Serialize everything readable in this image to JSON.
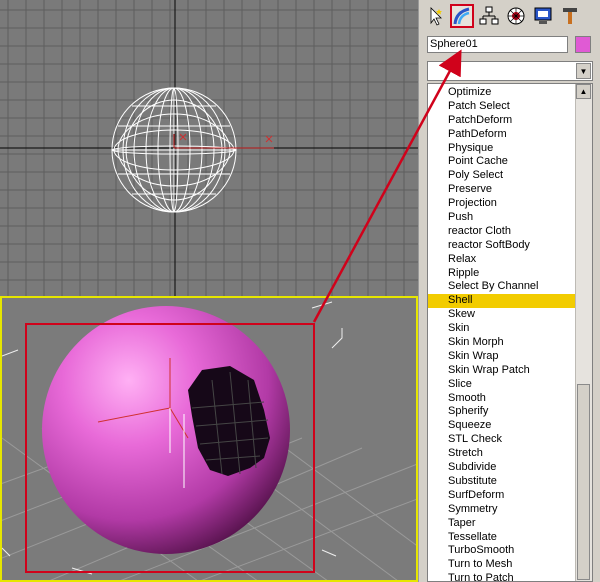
{
  "command_panel": {
    "tabs": [
      {
        "icon": "create-icon"
      },
      {
        "icon": "modify-icon",
        "highlighted": true
      },
      {
        "icon": "hierarchy-icon"
      },
      {
        "icon": "motion-icon"
      },
      {
        "icon": "display-icon"
      },
      {
        "icon": "utilities-icon"
      }
    ],
    "object_name": "Sphere01",
    "object_color": "#e05ad4",
    "modifier_list_value": ""
  },
  "modifiers": [
    {
      "label": "Optimize"
    },
    {
      "label": "Patch Select"
    },
    {
      "label": "PatchDeform"
    },
    {
      "label": "PathDeform"
    },
    {
      "label": "Physique"
    },
    {
      "label": "Point Cache"
    },
    {
      "label": "Poly Select"
    },
    {
      "label": "Preserve"
    },
    {
      "label": "Projection"
    },
    {
      "label": "Push"
    },
    {
      "label": "reactor Cloth"
    },
    {
      "label": "reactor SoftBody"
    },
    {
      "label": "Relax"
    },
    {
      "label": "Ripple"
    },
    {
      "label": "Select By Channel"
    },
    {
      "label": "Shell",
      "selected": true
    },
    {
      "label": "Skew"
    },
    {
      "label": "Skin"
    },
    {
      "label": "Skin Morph"
    },
    {
      "label": "Skin Wrap"
    },
    {
      "label": "Skin Wrap Patch"
    },
    {
      "label": "Slice"
    },
    {
      "label": "Smooth"
    },
    {
      "label": "Spherify"
    },
    {
      "label": "Squeeze"
    },
    {
      "label": "STL Check"
    },
    {
      "label": "Stretch"
    },
    {
      "label": "Subdivide"
    },
    {
      "label": "Substitute"
    },
    {
      "label": "SurfDeform"
    },
    {
      "label": "Symmetry"
    },
    {
      "label": "Taper"
    },
    {
      "label": "Tessellate"
    },
    {
      "label": "TurboSmooth"
    },
    {
      "label": "Turn to Mesh"
    },
    {
      "label": "Turn to Patch"
    }
  ],
  "colors": {
    "accent_red": "#d0021b",
    "viewport_active_border": "#e6e600",
    "selection_highlight": "#f2cc00",
    "sphere_pink": "#e05ad4"
  }
}
